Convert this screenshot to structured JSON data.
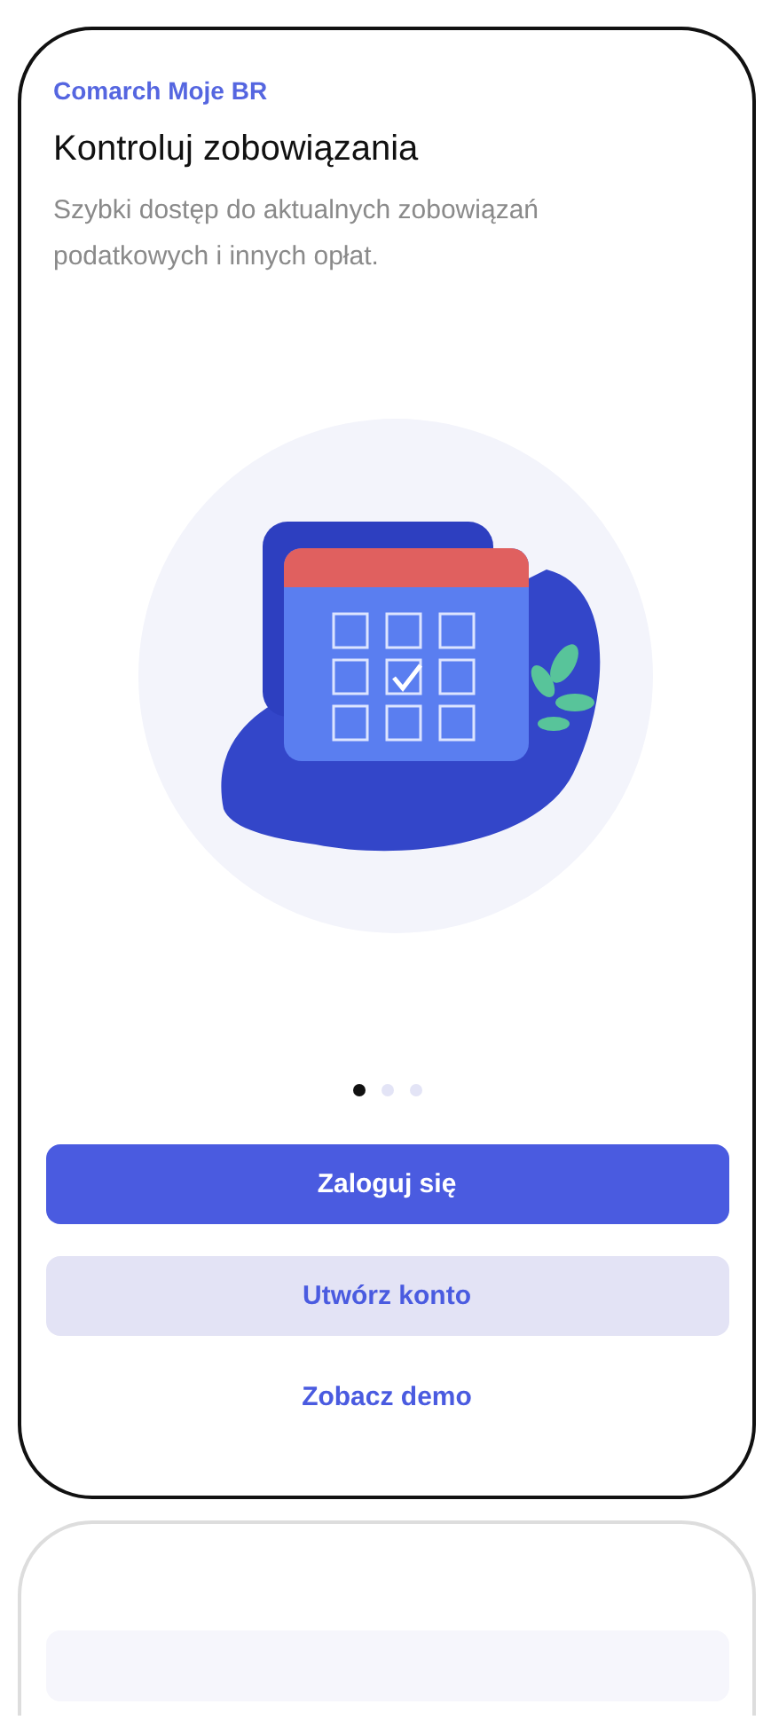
{
  "app_name": "Comarch Moje BR",
  "title": "Kontroluj zobowiązania",
  "subtitle": "Szybki dostęp do aktualnych zobowiązań podatkowych i innych opłat.",
  "pager": [
    {
      "selected": true
    },
    {
      "selected": false
    },
    {
      "selected": false
    }
  ],
  "buttons": [
    {
      "label": "Zaloguj się",
      "kind": "primary"
    },
    {
      "label": "Utwórz konto",
      "kind": "secondary"
    },
    {
      "label": "Zobacz demo",
      "kind": "link"
    }
  ]
}
